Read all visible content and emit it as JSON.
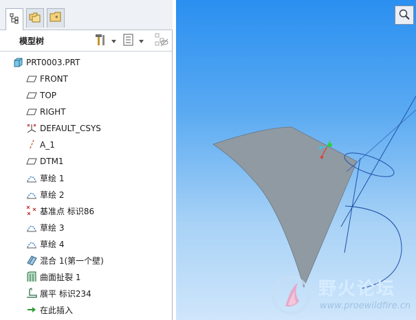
{
  "panel": {
    "title": "模型树",
    "tabs": [
      {
        "icon": "model-tree-tab-icon"
      },
      {
        "icon": "folder-browser-tab-icon"
      },
      {
        "icon": "favorites-tab-icon"
      }
    ],
    "header_buttons": [
      {
        "icon": "settings-tools-icon"
      },
      {
        "icon": "dropdown-arrow-icon"
      },
      {
        "icon": "tree-columns-icon"
      },
      {
        "icon": "dropdown-arrow-icon"
      },
      {
        "icon": "show-hidden-icon"
      }
    ]
  },
  "tree": {
    "items": [
      {
        "label": "PRT0003.PRT",
        "icon": "part-icon"
      },
      {
        "label": "FRONT",
        "icon": "datum-plane-icon"
      },
      {
        "label": "TOP",
        "icon": "datum-plane-icon"
      },
      {
        "label": "RIGHT",
        "icon": "datum-plane-icon"
      },
      {
        "label": "DEFAULT_CSYS",
        "icon": "coordinate-system-icon"
      },
      {
        "label": "A_1",
        "icon": "datum-axis-icon"
      },
      {
        "label": "DTM1",
        "icon": "datum-plane-icon"
      },
      {
        "label": "草绘 1",
        "icon": "sketch-icon"
      },
      {
        "label": "草绘 2",
        "icon": "sketch-icon"
      },
      {
        "label": "基准点 标识86",
        "icon": "datum-point-icon"
      },
      {
        "label": "草绘 3",
        "icon": "sketch-icon"
      },
      {
        "label": "草绘 4",
        "icon": "sketch-icon"
      },
      {
        "label": "混合 1(第一个壁)",
        "icon": "blend-wall-icon"
      },
      {
        "label": "曲面扯裂 1",
        "icon": "surface-rip-icon"
      },
      {
        "label": "展平 标识234",
        "icon": "unbend-icon"
      },
      {
        "label": "在此插入",
        "icon": "insert-here-arrow-icon"
      }
    ]
  },
  "viewport": {
    "zoom_icon": "zoom-fit-icon",
    "background_top": "#2a8ff0",
    "background_bottom": "#cfe6fb",
    "part_color": "#8f9aa3"
  },
  "watermark": {
    "title": "野火论坛",
    "url": "www.proewildfire.cn"
  }
}
